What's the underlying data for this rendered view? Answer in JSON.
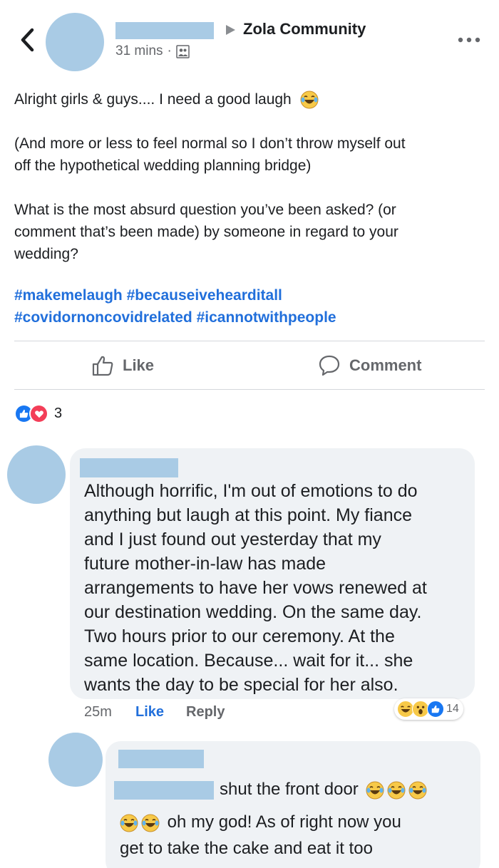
{
  "post": {
    "group": "Zola Community",
    "time": "31 mins",
    "separator": "·",
    "lines": [
      "Alright girls & guys.... I need a good laugh",
      "(And more or less to feel normal so I don’t throw myself out",
      "off the hypothetical wedding planning bridge)",
      "What is the most absurd question you’ve been asked? (or",
      "comment that’s been made)  by someone in regard to your",
      "wedding?"
    ],
    "hashtags": [
      "#makemelaugh",
      "#becauseivehearditall",
      "#covidornoncovidrelated",
      "#icannotwithpeople"
    ],
    "reaction_count": "3"
  },
  "actions": {
    "like": "Like",
    "comment": "Comment"
  },
  "comment1": {
    "lines": [
      "Although horrific, I'm out of emotions to do",
      "anything but laugh at this point. My fiance",
      "and I just found out yesterday that my",
      "future mother-in-law has made",
      "arrangements to have her vows renewed at",
      "our destination wedding. On the same day.",
      "Two hours prior to our ceremony. At the",
      "same location. Because... wait for it... she",
      "wants the day to be special for her also."
    ],
    "time": "25m",
    "like": "Like",
    "reply": "Reply",
    "reaction_count": "14"
  },
  "comment2": {
    "line1": "shut the front door",
    "line2": "oh my god! As of right now you",
    "line3": "get to take the cake and eat it too"
  },
  "colors": {
    "link": "#216fdb",
    "redaction": "#a9cbe5",
    "bubble": "#eff2f5"
  },
  "icons": [
    "back-icon",
    "caret-right-icon",
    "group-icon",
    "more-icon",
    "like-icon",
    "comment-icon",
    "laugh-emoji",
    "wow-emoji",
    "like-reaction",
    "love-reaction"
  ]
}
